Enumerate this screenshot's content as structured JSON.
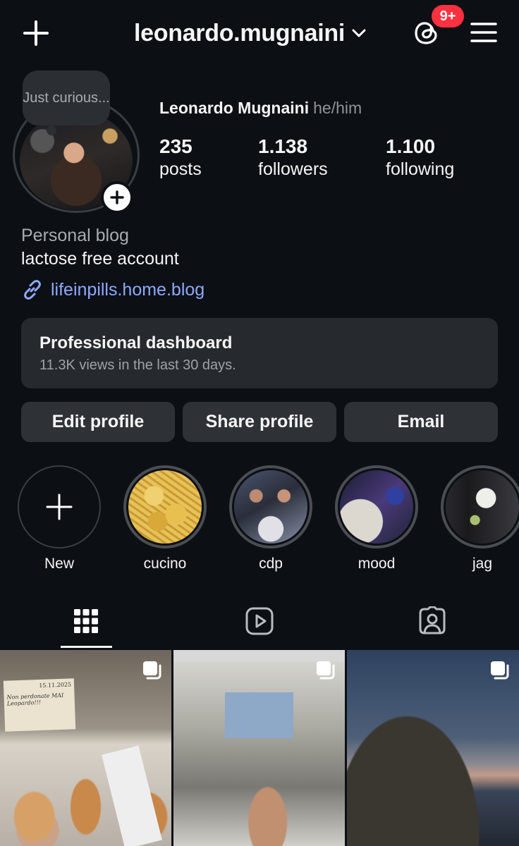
{
  "header": {
    "username": "leonardo.mugnaini",
    "threads_badge": "9+",
    "icons": [
      "plus-icon",
      "chevron-down-icon",
      "threads-icon",
      "menu-icon"
    ]
  },
  "profile": {
    "note": "Just curious...",
    "full_name": "Leonardo Mugnaini",
    "pronouns": "he/him",
    "stats": [
      {
        "value": "235",
        "label": "posts"
      },
      {
        "value": "1.138",
        "label": "followers"
      },
      {
        "value": "1.100",
        "label": "following"
      }
    ],
    "category": "Personal blog",
    "bio": "lactose free account",
    "link": "lifeinpills.home.blog"
  },
  "dashboard": {
    "title": "Professional dashboard",
    "subtitle": "11.3K views in the last 30 days."
  },
  "actions": {
    "edit": "Edit profile",
    "share": "Share profile",
    "email": "Email"
  },
  "highlights": [
    {
      "label": "New"
    },
    {
      "label": "cucino"
    },
    {
      "label": "cdp"
    },
    {
      "label": "mood"
    },
    {
      "label": "jag"
    }
  ],
  "tabs": [
    "grid-icon",
    "reels-icon",
    "tagged-icon"
  ],
  "grid_photos": [
    {
      "note": "Non perdonate MAI Leopardo!!!",
      "date": "15.11.2025"
    },
    {
      "caption": ""
    },
    {
      "caption": ""
    }
  ],
  "colors": {
    "background": "#0c1014",
    "badge": "#ff3040",
    "link": "#8fa8ff",
    "button": "#2e3136"
  }
}
